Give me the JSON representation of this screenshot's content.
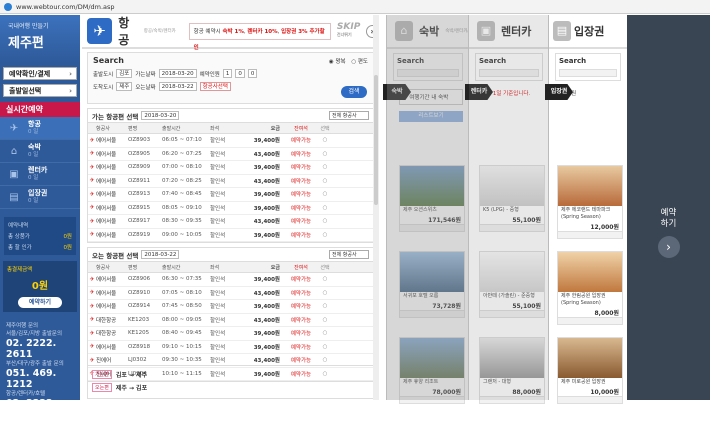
{
  "browser": {
    "url": "www.webtour.com/DM/dm.asp"
  },
  "sidebar": {
    "sub": "국내여행 만들기",
    "title": "제주편",
    "btn_reserve": "예약확인/결제",
    "btn_depart": "출발일선택",
    "realtime": "실시간예약",
    "cats": [
      {
        "label": "항공",
        "count": "0 일",
        "icon": "✈"
      },
      {
        "label": "숙박",
        "count": "0 일",
        "icon": "⌂"
      },
      {
        "label": "렌터카",
        "count": "0 일",
        "icon": "▣"
      },
      {
        "label": "입장권",
        "count": "0 일",
        "icon": "▤"
      }
    ],
    "cart_title": "예약내역",
    "cart_rows": [
      {
        "k": "총 상품가",
        "v": "0원"
      },
      {
        "k": "총 할 인가",
        "v": "0원"
      }
    ],
    "total_label": "총결제금액",
    "total": "0원",
    "pay_btn": "예약하기",
    "call_title": "제주여행 문의",
    "call_lines": [
      {
        "k": "서울/김포/지방 출발문의",
        "v": "02. 2222. 2611"
      },
      {
        "k": "부산/대구/광주 출발 문의",
        "v": "051. 469. 1212"
      },
      {
        "k": "항공/렌터카/호텔",
        "v": "02. 2222. 2633"
      }
    ]
  },
  "flight": {
    "title": "항공",
    "subtitle": "항공/숙박/렌터카",
    "promo_pre": "항공 예약시",
    "promo_a": "숙박 1%",
    "promo_b": "렌터카 10%",
    "promo_c": "입장권 3% 추가할인",
    "skip": "SKIP",
    "skip_sub": "건너뛰기",
    "search": {
      "title": "Search",
      "trip_a": "왕복",
      "trip_b": "편도",
      "dep_label": "출발도시",
      "dep_city": "김포",
      "dep_date_label": "가는날짜",
      "dep_date": "2018-03-20",
      "arr_label": "도착도시",
      "arr_city": "제주",
      "arr_date_label": "오는날짜",
      "arr_date": "2018-03-22",
      "adult_label": "예약인원",
      "adult": "1",
      "child": "0",
      "infant": "0",
      "airline": "항공사선택",
      "go_btn": "검색"
    },
    "out_title": "가는 항공편 선택",
    "out_date": "2018-03-20",
    "ret_title": "오는 항공편 선택",
    "ret_date": "2018-03-22",
    "sort": "전체 항공사",
    "cols": [
      "항공사",
      "편명",
      "출발시간",
      "좌석",
      "등급",
      "요금",
      "잔여석",
      "선택"
    ],
    "out_rows": [
      [
        "에어서울",
        "OZ8903",
        "06:05 ~ 07:10",
        "할인석",
        "일반",
        "39,400원",
        "예약가능"
      ],
      [
        "에어서울",
        "OZ8905",
        "06:20 ~ 07:25",
        "할인석",
        "일반",
        "43,400원",
        "예약가능"
      ],
      [
        "에어서울",
        "OZ8909",
        "07:00 ~ 08:10",
        "할인석",
        "일반",
        "39,400원",
        "예약가능"
      ],
      [
        "에어서울",
        "OZ8911",
        "07:20 ~ 08:25",
        "할인석",
        "일반",
        "43,400원",
        "예약가능"
      ],
      [
        "에어서울",
        "OZ8913",
        "07:40 ~ 08:45",
        "할인석",
        "일반",
        "39,400원",
        "예약가능"
      ],
      [
        "에어서울",
        "OZ8915",
        "08:05 ~ 09:10",
        "할인석",
        "일반",
        "39,400원",
        "예약가능"
      ],
      [
        "에어서울",
        "OZ8917",
        "08:30 ~ 09:35",
        "할인석",
        "일반",
        "43,400원",
        "예약가능"
      ],
      [
        "에어서울",
        "OZ8919",
        "09:00 ~ 10:05",
        "할인석",
        "일반",
        "39,400원",
        "예약가능"
      ]
    ],
    "ret_rows": [
      [
        "에어서울",
        "OZ8906",
        "06:30 ~ 07:35",
        "할인석",
        "일반",
        "39,400원",
        "예약가능"
      ],
      [
        "에어서울",
        "OZ8910",
        "07:05 ~ 08:10",
        "할인석",
        "일반",
        "43,400원",
        "예약가능"
      ],
      [
        "에어서울",
        "OZ8914",
        "07:45 ~ 08:50",
        "할인석",
        "일반",
        "39,400원",
        "예약가능"
      ],
      [
        "대한항공",
        "KE1203",
        "08:00 ~ 09:05",
        "할인석",
        "일반",
        "43,400원",
        "예약가능"
      ],
      [
        "대한항공",
        "KE1205",
        "08:40 ~ 09:45",
        "할인석",
        "일반",
        "39,400원",
        "예약가능"
      ],
      [
        "에어서울",
        "OZ8918",
        "09:10 ~ 10:15",
        "할인석",
        "일반",
        "39,400원",
        "예약가능"
      ],
      [
        "진에어",
        "LJ0302",
        "09:30 ~ 10:35",
        "할인석",
        "일반",
        "43,400원",
        "예약가능"
      ],
      [
        "진에어",
        "LJ0304",
        "10:10 ~ 11:15",
        "할인석",
        "일반",
        "39,400원",
        "예약가능"
      ]
    ],
    "itin_out_tag": "가는편",
    "itin_out": "김포 → 제주",
    "itin_ret_tag": "오는편",
    "itin_ret": "제주 → 김포"
  },
  "hotel": {
    "title": "숙박",
    "sub": "숙박/렌터카/입장권",
    "tab": "숙박",
    "search": "Search",
    "region": "지역",
    "date": "2018-03-20",
    "notice": "여행기간 내 숙박",
    "list_btn": "리스트보기",
    "cards": [
      {
        "name": "제주 오션스위츠",
        "price": "171,546원"
      },
      {
        "name": "서귀포 호텔 오름",
        "price": "73,728원"
      },
      {
        "name": "제주 휴양 리조트",
        "price": "78,000원"
      }
    ]
  },
  "car": {
    "title": "렌터카",
    "sub": "숙박/렌터카/입장권",
    "tab": "렌터카",
    "search": "Search",
    "date": "2018-03-22",
    "notice_pre": "차종",
    "notice": "1일 기준입니다.",
    "cards": [
      {
        "name": "K5 (LPG) - 중형",
        "price": "55,100원"
      },
      {
        "name": "아반떼 (가솔린) - 준중형",
        "price": "55,100원"
      },
      {
        "name": "그랜저 - 대형",
        "price": "88,000원"
      }
    ]
  },
  "ticket": {
    "title": "입장권",
    "sub": "숙박/렌터카/입장권",
    "tab": "입장권",
    "search": "Search",
    "date": "2018-03-20",
    "type_label": "입장권",
    "cards": [
      {
        "name": "제주 에코랜드 테마파크 (Spring Season)",
        "price": "12,000원"
      },
      {
        "name": "제주 한림공원 입장권 (Spring Season)",
        "price": "8,000원"
      },
      {
        "name": "제주 미로공원 입장권",
        "price": "10,000원"
      }
    ]
  },
  "right": {
    "label1": "예약",
    "label2": "하기",
    "arrow": "›"
  }
}
